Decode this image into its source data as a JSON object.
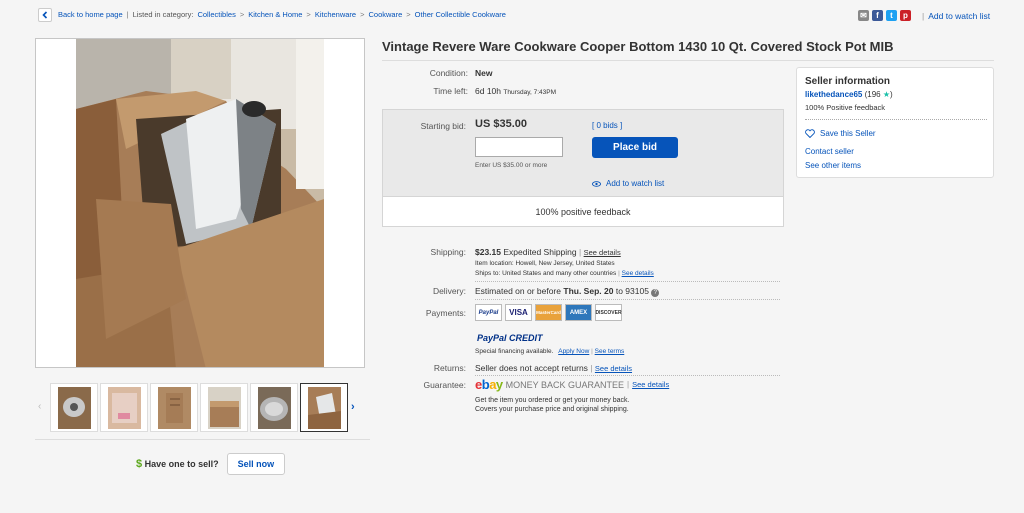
{
  "breadcrumb": {
    "back_label": "Back to home page",
    "listed_label": "Listed in category:",
    "categories": [
      "Collectibles",
      "Kitchen & Home",
      "Kitchenware",
      "Cookware",
      "Other Collectible Cookware"
    ]
  },
  "header": {
    "watch_label": "Add to watch list"
  },
  "share_icons": [
    "email-icon",
    "facebook-icon",
    "twitter-icon",
    "pinterest-icon"
  ],
  "item": {
    "title": "Vintage Revere Ware Cookware Cooper Bottom 1430 10 Qt. Covered Stock Pot MIB",
    "condition_label": "Condition:",
    "condition": "New",
    "time_left_label": "Time left:",
    "time_left": "6d 10h",
    "time_left_detail": "Thursday, 7:43PM"
  },
  "bid": {
    "starting_label": "Starting bid:",
    "price": "US $35.00",
    "bids": "[ 0 bids ]",
    "hint": "Enter US $35.00 or more",
    "place_bid": "Place bid",
    "watch": "Add to watch list",
    "feedback": "100% positive feedback"
  },
  "shipping": {
    "label": "Shipping:",
    "cost": "$23.15",
    "method": "Expedited Shipping",
    "details": "See details",
    "location": "Item location:  Howell, New Jersey, United States",
    "ships_to_label": "Ships to:",
    "ships_to": "United States and many other countries",
    "ships_details": "See details"
  },
  "delivery": {
    "label": "Delivery:",
    "text_pre": "Estimated on or before",
    "date": "Thu. Sep. 20",
    "text_post": "to 93105"
  },
  "payments": {
    "label": "Payments:",
    "methods": [
      "PayPal",
      "VISA",
      "MasterCard",
      "AMEX",
      "DISCOVER"
    ],
    "credit_logo": "PayPal CREDIT",
    "financing": "Special financing available.",
    "apply": "Apply Now",
    "terms": "See terms"
  },
  "returns": {
    "label": "Returns:",
    "text": "Seller does not accept returns",
    "details": "See details"
  },
  "guarantee": {
    "label": "Guarantee:",
    "logo": "ebay",
    "title": "MONEY BACK GUARANTEE",
    "details": "See details",
    "line1": "Get the item you ordered or get your money back.",
    "line2": "Covers your purchase price and original shipping."
  },
  "seller": {
    "heading": "Seller information",
    "name": "likethedance65",
    "score": "(196",
    "score_end": ")",
    "feedback": "100% Positive feedback",
    "save": "Save this Seller",
    "contact": "Contact seller",
    "other": "See other items"
  },
  "sell": {
    "question": "Have one to sell?",
    "button": "Sell now"
  }
}
